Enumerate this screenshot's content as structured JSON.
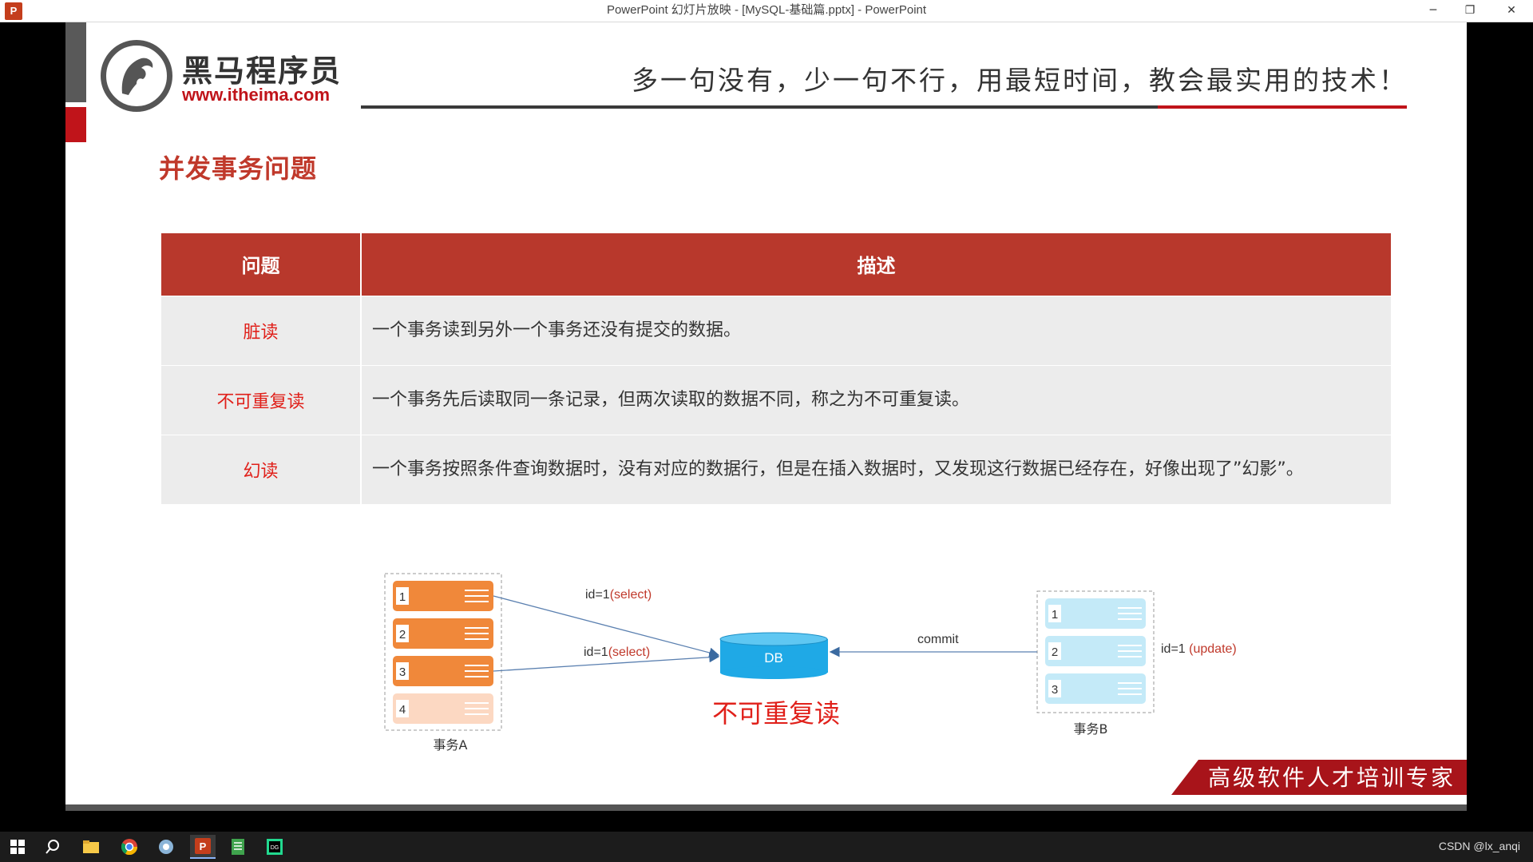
{
  "window": {
    "title": "PowerPoint 幻灯片放映 - [MySQL-基础篇.pptx] - PowerPoint",
    "app_icon": "P",
    "minimize": "─",
    "restore": "❐",
    "close": "✕"
  },
  "slide": {
    "logo_name": "黑马程序员",
    "logo_url": "www.itheima.com",
    "slogan": "多一句没有，少一句不行，用最短时间，教会最实用的技术！",
    "title": "并发事务问题",
    "table": {
      "headers": [
        "问题",
        "描述"
      ],
      "rows": [
        {
          "name": "脏读",
          "desc": "一个事务读到另外一个事务还没有提交的数据。"
        },
        {
          "name": "不可重复读",
          "desc": "一个事务先后读取同一条记录，但两次读取的数据不同，称之为不可重复读。"
        },
        {
          "name": "幻读",
          "desc": "一个事务按照条件查询数据时，没有对应的数据行，但是在插入数据时，又发现这行数据已经存在，好像出现了”幻影”。"
        }
      ]
    },
    "diagram": {
      "txn_a_label": "事务A",
      "txn_b_label": "事务B",
      "txn_a_rows": [
        "1",
        "2",
        "3",
        "4"
      ],
      "txn_b_rows": [
        "1",
        "2",
        "3"
      ],
      "db_label": "DB",
      "select1_prefix": "id=1",
      "select1_op": "(select)",
      "select2_prefix": "id=1",
      "select2_op": "(select)",
      "commit_label": "commit",
      "update_prefix": "id=1",
      "update_op": "(update)",
      "caption": "不可重复读"
    },
    "banner": "高级软件人才培训专家"
  },
  "taskbar": {
    "icons": [
      "windows-start-icon",
      "search-icon",
      "file-explorer-icon",
      "chrome-icon",
      "app-icon",
      "powerpoint-icon",
      "notepad-icon",
      "datagrip-icon"
    ],
    "tray": "CSDN @lx_anqi"
  },
  "colors": {
    "table_header": "#b8382c",
    "accent_red": "#e0201a",
    "txn_a_orange": "#f0883a",
    "txn_b_blue": "#c4eaf8",
    "db_blue": "#1fa9e6"
  }
}
